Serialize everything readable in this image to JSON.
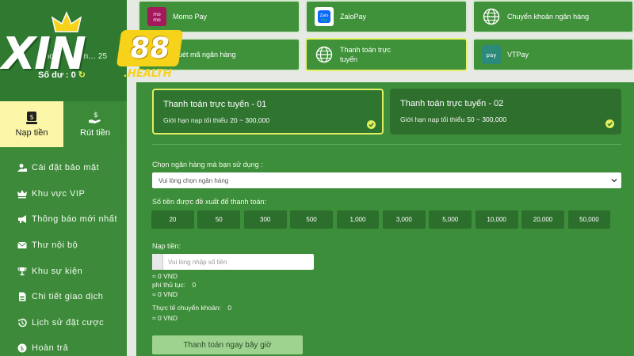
{
  "brand": {
    "logo_main": "XIN",
    "logo_number": "88",
    "logo_sub": ".HEALTH"
  },
  "account": {
    "name_label": "Khoản … dun… 25",
    "balance_label": "Số dư : 0"
  },
  "tabs": [
    {
      "label": "Nạp tiền",
      "icon": "wallet-icon",
      "active": true
    },
    {
      "label": "Rút tiền",
      "icon": "cash-withdraw-icon",
      "active": false
    }
  ],
  "menu": [
    {
      "label": "Cài đặt bảo mật",
      "icon": "user-lock-icon"
    },
    {
      "label": "Khu vực VIP",
      "icon": "crown-icon"
    },
    {
      "label": "Thông báo mới nhất",
      "icon": "megaphone-icon"
    },
    {
      "label": "Thư nội bộ",
      "icon": "envelope-icon"
    },
    {
      "label": "Khu sự kiện",
      "icon": "trophy-icon"
    },
    {
      "label": "Chi tiết giao dịch",
      "icon": "document-icon"
    },
    {
      "label": "Lịch sử đặt cược",
      "icon": "history-icon"
    },
    {
      "label": "Hoàn trả",
      "icon": "coin-return-icon"
    }
  ],
  "payment_methods": [
    {
      "label": "Momo Pay",
      "icon": "momo-icon"
    },
    {
      "label": "ZaloPay",
      "icon": "zalopay-icon"
    },
    {
      "label": "Chuyển khoản ngân hàng",
      "icon": "globe-icon"
    },
    {
      "label": "Quét mã ngân hàng",
      "icon": "qr-icon"
    },
    {
      "label": "Thanh toán trực tuyến",
      "icon": "globe-icon",
      "selected": true
    },
    {
      "label": "VTPay",
      "icon": "viettelpay-icon"
    }
  ],
  "options": [
    {
      "title": "Thanh toán trực tuyến - 01",
      "limit_label": "Giới hạn nạp tối thiểu",
      "limit_range": "20 ~ 300,000",
      "selected": true
    },
    {
      "title": "Thanh toán trực tuyến - 02",
      "limit_label": "Giới hạn nạp tối thiểu",
      "limit_range": "50 ~ 300,000",
      "selected": true
    }
  ],
  "bank": {
    "label": "Chọn ngân hàng mà bạn sử dụng :",
    "selected": "Vui lòng chọn ngân hàng"
  },
  "suggested": {
    "label": "Số tiền được đề xuất để thanh toán:",
    "amounts": [
      "20",
      "50",
      "300",
      "500",
      "1,000",
      "3,000",
      "5,000",
      "10,000",
      "20,000",
      "50,000"
    ]
  },
  "deposit": {
    "label": "Nạp tiền:",
    "placeholder": "Vui lòng nhập số tiền",
    "equiv": "≈ 0 VND",
    "fee_label": "phí thủ tục:",
    "fee_value": "0",
    "fee_equiv": "≈ 0 VND",
    "actual_label": "Thực tế chuyển khoản:",
    "actual_value": "0",
    "actual_equiv": "≈ 0 VND"
  },
  "submit_label": "Thanh toán ngay bây giờ",
  "colors": {
    "panel": "#3d8e3a",
    "accent": "#e2ef5a",
    "active_tab": "#fbf6a8"
  }
}
